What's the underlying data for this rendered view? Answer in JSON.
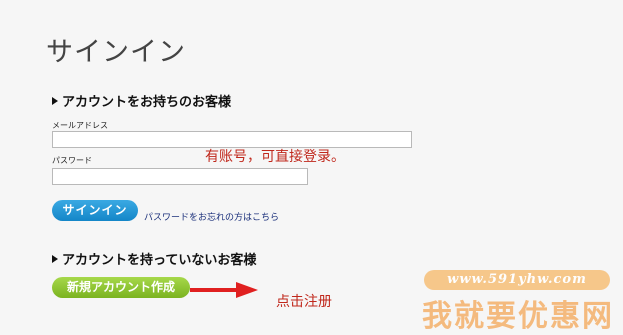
{
  "page": {
    "title": "サインイン"
  },
  "signin_section": {
    "heading": "アカウントをお持ちのお客様",
    "email_label": "メールアドレス",
    "email_value": "",
    "password_label": "パスワード",
    "password_value": "",
    "signin_button": "サインイン",
    "forgot_link": "パスワードをお忘れの方はこちら"
  },
  "register_section": {
    "heading": "アカウントを持っていないお客様",
    "register_button": "新規アカウント作成"
  },
  "annotations": {
    "login_note": "有账号，可直接登录。",
    "register_note": "点击注册",
    "arrow_color": "#e02020"
  },
  "watermark": {
    "url": "www.591yhw.com",
    "name": "我就要优惠网"
  },
  "colors": {
    "signin_button": "#1f93d4",
    "register_button": "#8cc63f",
    "annotation": "#c0281c"
  }
}
